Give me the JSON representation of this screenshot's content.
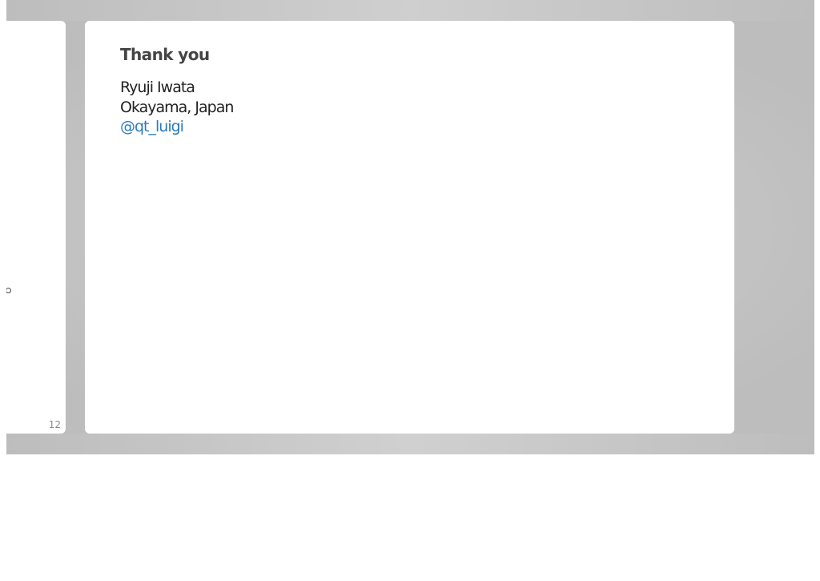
{
  "previous_slide": {
    "page_number": "12"
  },
  "current_slide": {
    "title": "Thank you",
    "name": "Ryuji Iwata",
    "location": "Okayama, Japan",
    "twitter_handle": "@qt_luigi"
  },
  "colors": {
    "background_gray": "#c4c4c4",
    "slide_bg": "#ffffff",
    "link": "#2a7ac0",
    "title_text": "#444444",
    "body_text": "#222222"
  }
}
